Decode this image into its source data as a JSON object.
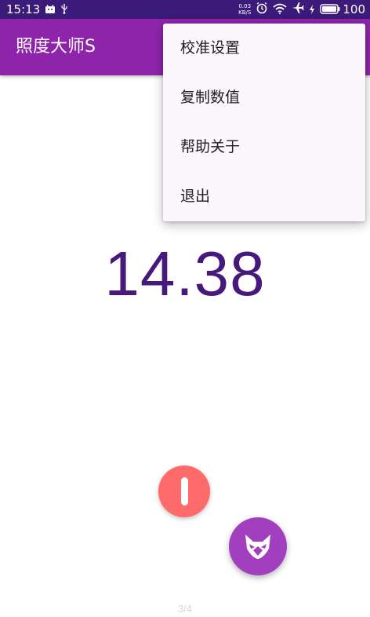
{
  "status_bar": {
    "time": "15:13",
    "net_speed_value": "0.03",
    "net_speed_unit": "KB/S",
    "battery": "100",
    "icons": [
      "android-debug-icon",
      "usb-icon",
      "alarm-icon",
      "wifi-icon",
      "airplane-icon",
      "charging-icon",
      "battery-icon"
    ]
  },
  "app_bar": {
    "title": "照度大师S"
  },
  "reading": {
    "value": "14.38"
  },
  "menu": {
    "items": [
      {
        "label": "校准设置"
      },
      {
        "label": "复制数值"
      },
      {
        "label": "帮助关于"
      },
      {
        "label": "退出"
      }
    ]
  },
  "pager": {
    "indicator": "3/4"
  },
  "colors": {
    "status_bar": "#3b1a79",
    "app_bar": "#8e24aa",
    "reading_text": "#47197a",
    "record_button": "#ff6b6b",
    "fab": "#a23fbf"
  }
}
